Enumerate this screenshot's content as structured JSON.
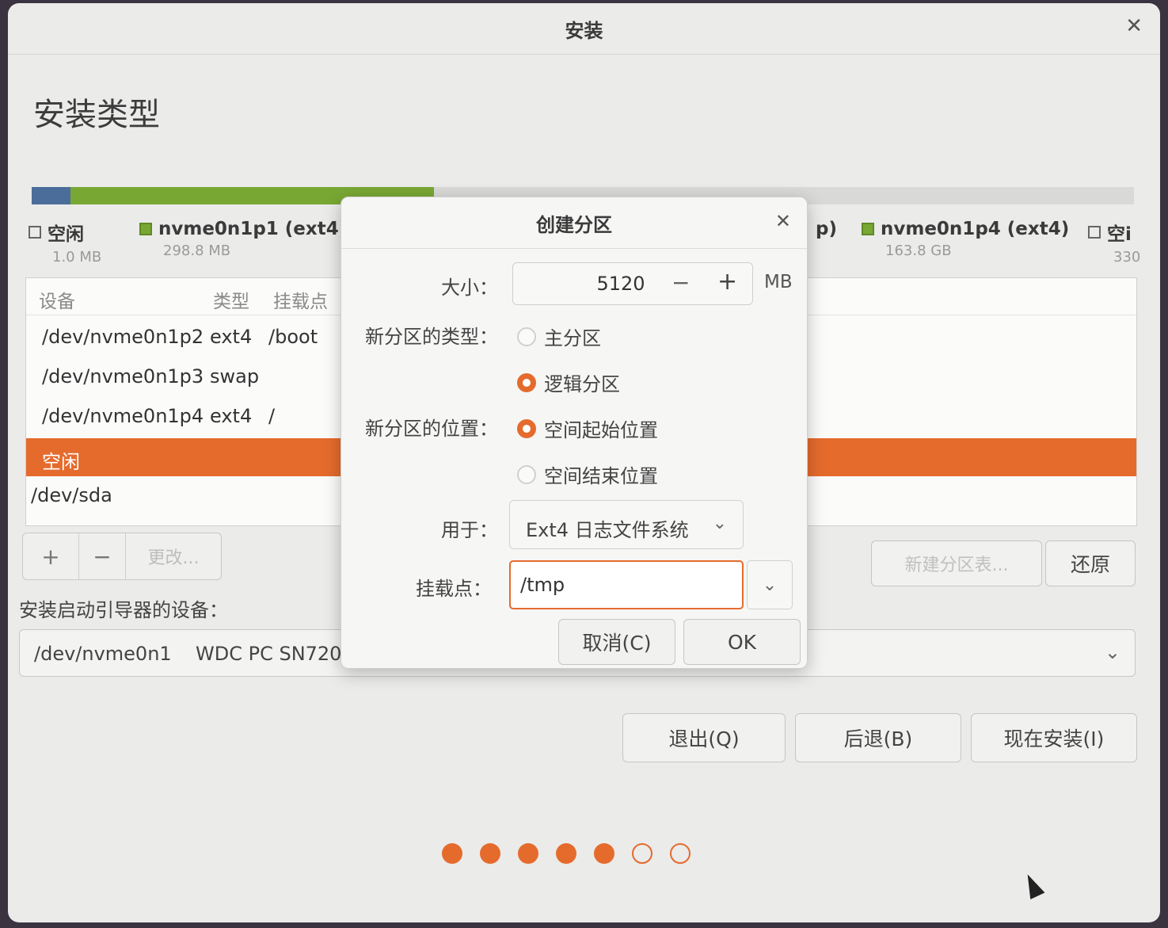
{
  "window": {
    "title": "安装",
    "heading": "安装类型"
  },
  "colors": {
    "accent": "#e56b2d",
    "partition_green": "#79a734",
    "partition_blue": "#4a6d99"
  },
  "usage_bar": [
    {
      "name": "free",
      "color": "#4a6d99",
      "fraction": 0.035
    },
    {
      "name": "nvme0n1p1",
      "color": "#79a734",
      "fraction": 0.33
    },
    {
      "name": "rest",
      "color": "#d9d9d7",
      "fraction": 0.635
    }
  ],
  "legend": [
    {
      "label": "空闲",
      "size": "1.0 MB",
      "kind": "empty"
    },
    {
      "label": "nvme0n1p1 (ext4)",
      "size": "298.8 MB",
      "kind": "green"
    },
    {
      "label": "p)",
      "size": "",
      "kind": "none"
    },
    {
      "label": "nvme0n1p4 (ext4)",
      "size": "163.8 GB",
      "kind": "green"
    },
    {
      "label": "空i",
      "size": "330",
      "kind": "empty"
    }
  ],
  "table": {
    "headers": {
      "device": "设备",
      "type": "类型",
      "mount": "挂载点"
    },
    "rows": [
      {
        "device": "/dev/nvme0n1p2",
        "type": "ext4",
        "mount": "/boot"
      },
      {
        "device": "/dev/nvme0n1p3",
        "type": "swap",
        "mount": ""
      },
      {
        "device": "/dev/nvme0n1p4",
        "type": "ext4",
        "mount": "/"
      },
      {
        "device": "空闲",
        "type": "",
        "mount": ""
      },
      {
        "device": "/dev/sda",
        "type": "",
        "mount": ""
      }
    ]
  },
  "tools": {
    "add": "+",
    "remove": "−",
    "change": "更改..."
  },
  "table_buttons": {
    "new_table": "新建分区表...",
    "revert": "还原"
  },
  "boot": {
    "label": "安装启动引导器的设备：",
    "device": "/dev/nvme0n1",
    "model": "WDC PC SN720"
  },
  "nav": {
    "quit": "退出(Q)",
    "back": "后退(B)",
    "install": "现在安装(I)"
  },
  "progress": {
    "steps_total": 7,
    "steps_done": 5
  },
  "dialog": {
    "title": "创建分区",
    "size_label": "大小：",
    "size_value": "5120",
    "size_unit": "MB",
    "type_label": "新分区的类型：",
    "type_primary": "主分区",
    "type_logical": "逻辑分区",
    "location_label": "新分区的位置：",
    "location_start": "空间起始位置",
    "location_end": "空间结束位置",
    "use_label": "用于：",
    "use_value": "Ext4 日志文件系统",
    "mount_label": "挂载点：",
    "mount_value": "/tmp",
    "cancel": "取消(C)",
    "ok": "OK"
  }
}
